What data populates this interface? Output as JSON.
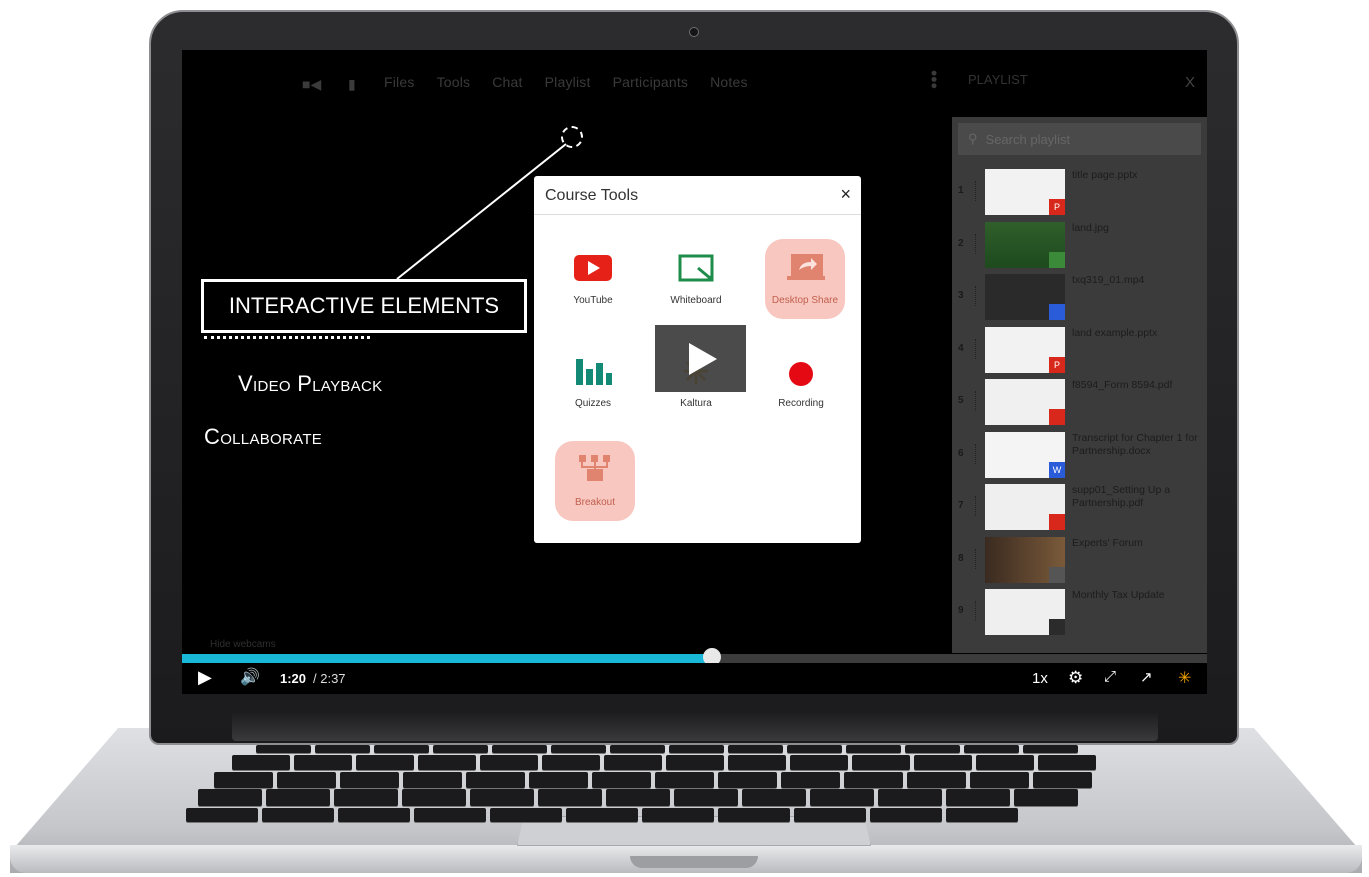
{
  "navbar": {
    "items": [
      "Files",
      "Tools",
      "Chat",
      "Playlist",
      "Participants",
      "Notes"
    ]
  },
  "slide": {
    "box_label": "INTERACTIVE ELEMENTS",
    "video_playback": "Video Playback",
    "collaborate": "Collaborate",
    "hide_webcams": "Hide webcams"
  },
  "playlist": {
    "title": "PLAYLIST",
    "close": "X",
    "search_placeholder": "Search playlist",
    "items": [
      {
        "num": "1",
        "name": "title page.pptx",
        "badge": "P",
        "badge_color": "#d8281b"
      },
      {
        "num": "2",
        "name": "land.jpg",
        "badge": "",
        "badge_color": "#3a8a3a"
      },
      {
        "num": "3",
        "name": "txq319_01.mp4",
        "badge": "",
        "badge_color": "#2a5bd8"
      },
      {
        "num": "4",
        "name": "land example.pptx",
        "badge": "P",
        "badge_color": "#d8281b"
      },
      {
        "num": "5",
        "name": "f8594_Form 8594.pdf",
        "badge": "",
        "badge_color": "#d8281b"
      },
      {
        "num": "6",
        "name": "Transcript for Chapter 1 for Partnership.docx",
        "badge": "W",
        "badge_color": "#2a5bd8"
      },
      {
        "num": "7",
        "name": "supp01_Setting Up a Partnership.pdf",
        "badge": "",
        "badge_color": "#d8281b"
      },
      {
        "num": "8",
        "name": "Experts' Forum",
        "badge": "",
        "badge_color": "#555555"
      },
      {
        "num": "9",
        "name": "Monthly Tax Update",
        "badge": "",
        "badge_color": "#2b2b2b"
      }
    ]
  },
  "modal": {
    "title": "Course Tools",
    "close": "×",
    "tools": [
      {
        "label": "YouTube",
        "icon": "youtube-icon"
      },
      {
        "label": "Whiteboard",
        "icon": "whiteboard-icon"
      },
      {
        "label": "Desktop Share",
        "icon": "desktop-share-icon"
      },
      {
        "label": "Quizzes",
        "icon": "quizzes-icon"
      },
      {
        "label": "Kaltura",
        "icon": "kaltura-icon"
      },
      {
        "label": "Recording",
        "icon": "record-icon"
      },
      {
        "label": "Breakout",
        "icon": "breakout-icon"
      }
    ]
  },
  "player": {
    "current_time": "1:20",
    "duration": "/ 2:37",
    "progress": 0.516,
    "speed": "1x"
  },
  "colors": {
    "progress": "#19b8d8",
    "highlight": "#f8c7bf",
    "youtube": "#e62117",
    "whiteboard": "#1e8c4a",
    "quizzes": "#138a76",
    "recording": "#e50914"
  }
}
